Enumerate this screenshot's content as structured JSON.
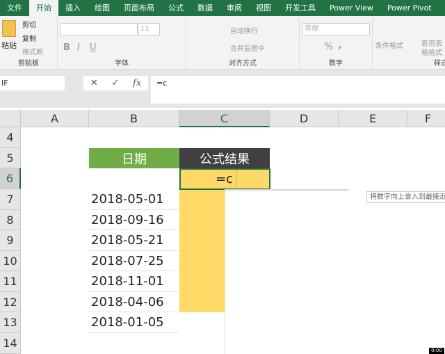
{
  "tabs": [
    "文件",
    "开始",
    "插入",
    "绘图",
    "页面布局",
    "公式",
    "数据",
    "审阅",
    "视图",
    "开发工具",
    "Power View",
    "Power Pivot"
  ],
  "ribbon": {
    "clipboard": {
      "paste": "粘贴",
      "cut": "剪切",
      "copy": "复制",
      "format_painter": "格式刷",
      "label": "剪贴板"
    },
    "font": {
      "size": "11",
      "bold": "B",
      "italic": "I",
      "underline": "U",
      "label": "字体"
    },
    "align": {
      "wrap": "自动换行",
      "merge": "合并后居中",
      "label": "对齐方式"
    },
    "number": {
      "format": "常规",
      "percent": "%",
      "comma": ",",
      "label": "数字"
    },
    "styles": {
      "conditional": "条件格式",
      "table": "套用表格格式",
      "label": "样式"
    }
  },
  "formula_bar": {
    "name_box": "IF",
    "cancel": "✕",
    "enter": "✓",
    "fx": "fx",
    "value": "=c"
  },
  "columns": [
    "A",
    "B",
    "C",
    "D",
    "E",
    "F"
  ],
  "rows": [
    "4",
    "5",
    "6",
    "7",
    "8",
    "9",
    "10",
    "11",
    "12",
    "13",
    "14"
  ],
  "table": {
    "headers": [
      "日期",
      "公式结果"
    ],
    "dates": [
      "2018-05-01",
      "2018-09-16",
      "2018-05-21",
      "2018-07-25",
      "2018-11-01",
      "2018-04-06",
      "2018-01-05"
    ],
    "editing": "=c"
  },
  "tooltip": "将数字向上舍入到最接近",
  "timer": "0:00",
  "colors": {
    "green": "#217346",
    "header_green": "#70ad47",
    "header_dark": "#404040",
    "yellow": "#ffd966"
  }
}
